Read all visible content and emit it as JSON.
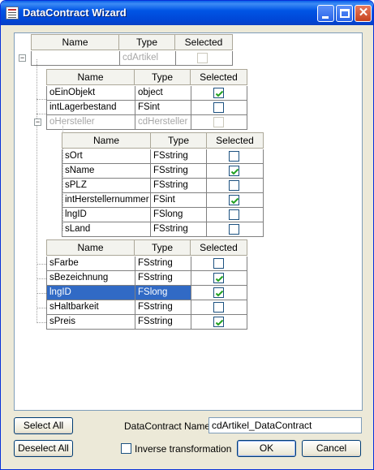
{
  "window": {
    "title": "DataContract Wizard"
  },
  "columns": {
    "name": "Name",
    "type": "Type",
    "selected": "Selected"
  },
  "root": {
    "name": "",
    "type": "cdArtikel",
    "selected": false
  },
  "artikel_rows": [
    {
      "name": "oEinObjekt",
      "type": "object",
      "selected": true
    },
    {
      "name": "intLagerbestand",
      "type": "FSint",
      "selected": false
    },
    {
      "name": "oHersteller",
      "type": "cdHersteller",
      "selected": false,
      "disabled": true
    }
  ],
  "hersteller_rows": [
    {
      "name": "sOrt",
      "type": "FSstring",
      "selected": false
    },
    {
      "name": "sName",
      "type": "FSstring",
      "selected": true
    },
    {
      "name": "sPLZ",
      "type": "FSstring",
      "selected": false
    },
    {
      "name": "intHerstellernummer",
      "type": "FSint",
      "selected": true
    },
    {
      "name": "lngID",
      "type": "FSlong",
      "selected": false
    },
    {
      "name": "sLand",
      "type": "FSstring",
      "selected": false
    }
  ],
  "artikel_rows2": [
    {
      "name": "sFarbe",
      "type": "FSstring",
      "selected": false
    },
    {
      "name": "sBezeichnung",
      "type": "FSstring",
      "selected": true
    },
    {
      "name": "lngID",
      "type": "FSlong",
      "selected": true,
      "highlighted": true
    },
    {
      "name": "sHaltbarkeit",
      "type": "FSstring",
      "selected": false
    },
    {
      "name": "sPreis",
      "type": "FSstring",
      "selected": true
    }
  ],
  "footer": {
    "select_all": "Select All",
    "deselect_all": "Deselect All",
    "contract_name_label": "DataContract Name",
    "contract_name_value": "cdArtikel_DataContract",
    "inverse_label": "Inverse transformation",
    "inverse_checked": false,
    "ok": "OK",
    "cancel": "Cancel"
  }
}
